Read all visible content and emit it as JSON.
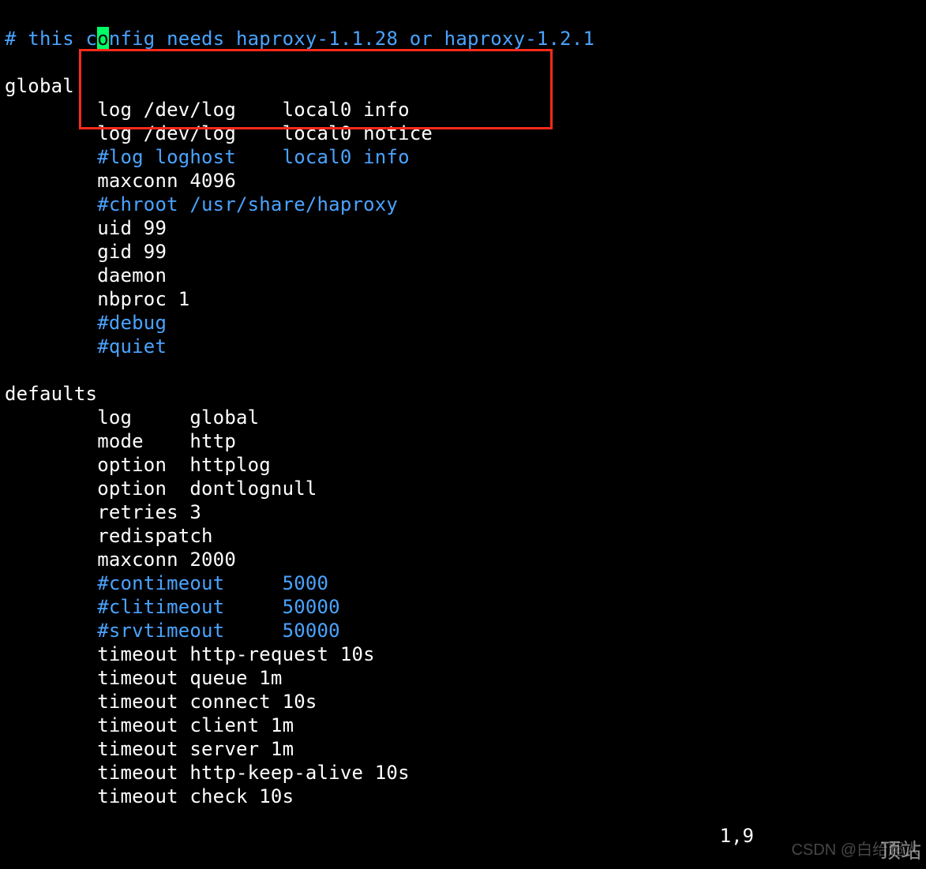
{
  "header": {
    "comment_prefix": "# this c",
    "cursor_char": "o",
    "comment_suffix": "nfig needs haproxy-1.1.28 or haproxy-1.2.1"
  },
  "sections": {
    "global_keyword": "global",
    "global_lines": {
      "log1": "        log /dev/log    local0 info",
      "log2": "        log /dev/log    local0 notice",
      "log_comment": "        #log loghost    local0 info",
      "maxconn": "        maxconn 4096",
      "chroot": "        #chroot /usr/share/haproxy",
      "uid": "        uid 99",
      "gid": "        gid 99",
      "daemon": "        daemon",
      "nbproc": "        nbproc 1",
      "debug": "        #debug",
      "quiet": "        #quiet"
    },
    "defaults_keyword": "defaults",
    "defaults_lines": {
      "log": "        log     global",
      "mode": "        mode    http",
      "option1": "        option  httplog",
      "option2": "        option  dontlognull",
      "retries": "        retries 3",
      "redispatch": "        redispatch",
      "maxconn": "        maxconn 2000",
      "contimeout": "        #contimeout     5000",
      "clitimeout": "        #clitimeout     50000",
      "srvtimeout": "        #srvtimeout     50000",
      "t_http_req": "        timeout http-request 10s",
      "t_queue": "        timeout queue 1m",
      "t_connect": "        timeout connect 10s",
      "t_client": "        timeout client 1m",
      "t_server": "        timeout server 1m",
      "t_keepalive": "        timeout http-keep-alive 10s",
      "t_check": "        timeout check 10s"
    }
  },
  "status_bar": {
    "position": "1,9"
  },
  "watermark": "CSDN @白给超人",
  "corner": "顶站"
}
